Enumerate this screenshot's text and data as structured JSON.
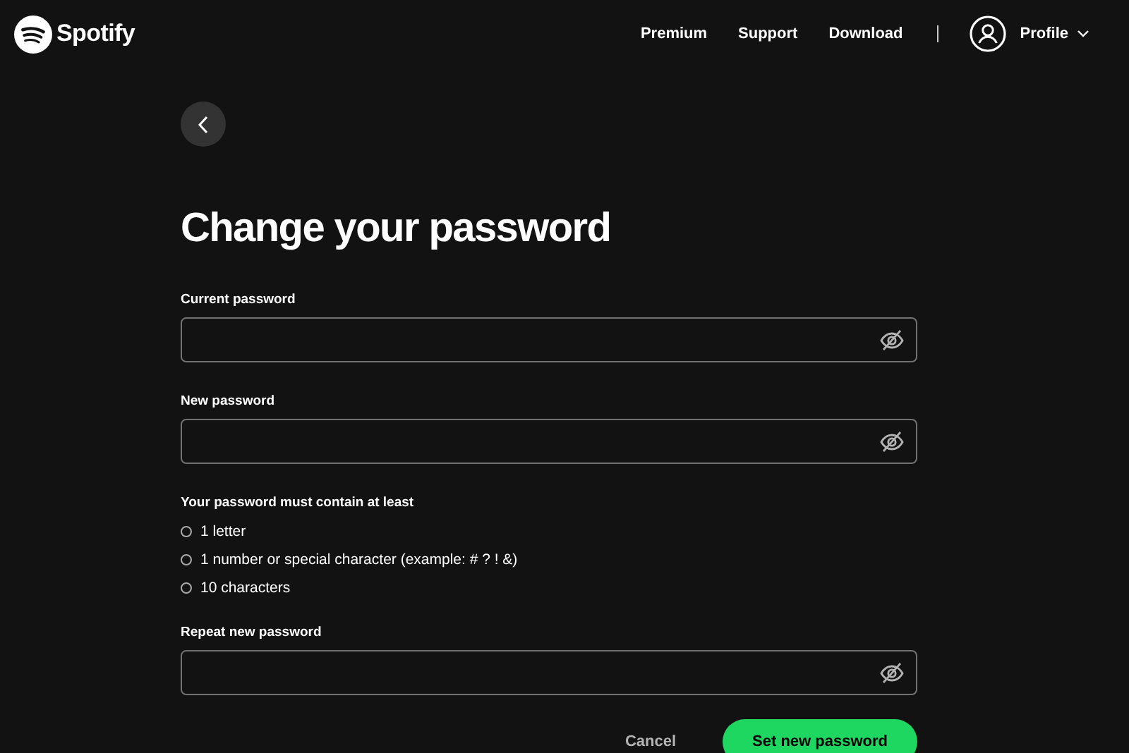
{
  "header": {
    "brand": "Spotify",
    "nav": [
      "Premium",
      "Support",
      "Download"
    ],
    "profile": "Profile"
  },
  "title": "Change your password",
  "fields": [
    {
      "label": "Current password"
    },
    {
      "label": "New password"
    }
  ],
  "requirements": {
    "heading": "Your password must contain at least",
    "items": [
      {
        "text": "1 letter",
        "met": false
      },
      {
        "text": "1 number or special character (example: # ? ! &)",
        "met": false
      },
      {
        "text": "10 characters",
        "met": false
      }
    ]
  },
  "repeat_field": {
    "label": "Repeat new password"
  },
  "buttons": {
    "cancel": "Cancel",
    "submit": "Set new password"
  }
}
